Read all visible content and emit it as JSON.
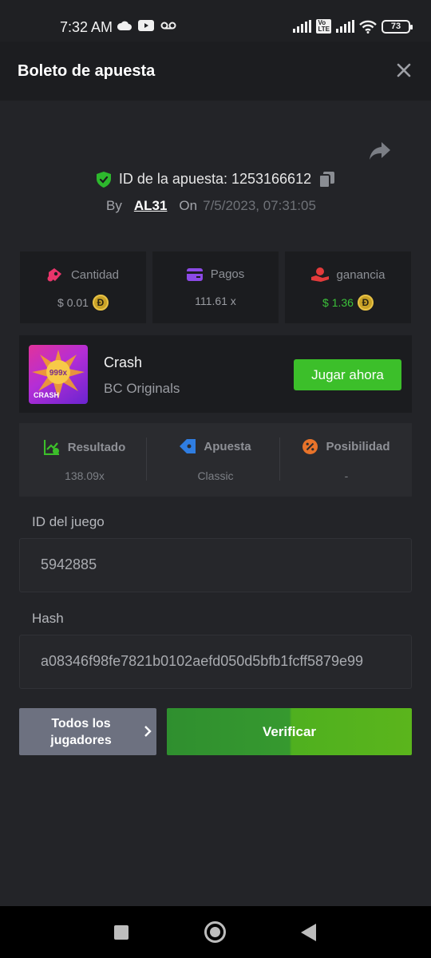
{
  "status_bar": {
    "time": "7:32 AM",
    "battery": "73",
    "icons": [
      "cloud-icon",
      "youtube-icon",
      "voicemail-icon",
      "signal-icon",
      "volte-icon",
      "signal-icon",
      "wifi-icon",
      "battery-icon"
    ]
  },
  "header": {
    "title": "Boleto de apuesta",
    "close_icon": "close-icon"
  },
  "bet": {
    "id_label": "ID de la apuesta: 1253166612",
    "by_label": "By",
    "user": "AL31",
    "on_label": "On",
    "date": "7/5/2023, 07:31:05"
  },
  "stats": [
    {
      "label": "Cantidad",
      "value": "$ 0.01",
      "coin": "Ð",
      "icon": "money-bag-icon",
      "color": "#e9356b"
    },
    {
      "label": "Pagos",
      "value": "111.61 x",
      "coin": "",
      "icon": "wallet-icon",
      "color": "#8c4ae6"
    },
    {
      "label": "ganancia",
      "value": "$ 1.36",
      "coin": "Ð",
      "icon": "hand-coin-icon",
      "color": "#e33b3b"
    }
  ],
  "game": {
    "name": "Crash",
    "provider": "BC Originals",
    "thumb_text": "999x",
    "thumb_caption": "CRASH",
    "play_label": "Jugar ahora"
  },
  "result": [
    {
      "label": "Resultado",
      "value": "138.09x",
      "icon": "chart-check-icon",
      "color": "#3cbf2a"
    },
    {
      "label": "Apuesta",
      "value": "Classic",
      "icon": "ticket-icon",
      "color": "#2f7de1"
    },
    {
      "label": "Posibilidad",
      "value": "-",
      "icon": "percent-icon",
      "color": "#e8732a"
    }
  ],
  "fields": {
    "game_id_label": "ID del juego",
    "game_id_value": "5942885",
    "hash_label": "Hash",
    "hash_value": "a08346f98fe7821b0102aefd050d5bfb1fcff5879e99"
  },
  "actions": {
    "all_players_line1": "Todos los",
    "all_players_line2": "jugadores",
    "verify_label": "Verificar"
  },
  "colors": {
    "accent_green": "#3cbf2a",
    "background": "#232428",
    "card": "#1b1c1f"
  }
}
